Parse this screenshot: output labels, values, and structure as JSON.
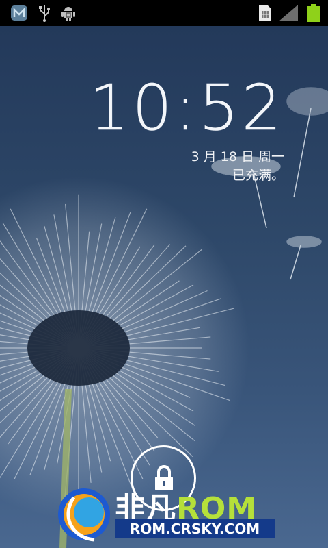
{
  "status_bar": {
    "left_icons": [
      "notification-app-icon",
      "usb-icon",
      "android-debug-icon"
    ],
    "right_icons": [
      "sim-card-icon",
      "signal-icon",
      "battery-icon"
    ],
    "battery_color": "#8fd11a"
  },
  "lockscreen": {
    "time": "10:52",
    "date": "3 月 18 日 周一",
    "charging_status": "已充满。",
    "unlock_icon": "lock-icon"
  },
  "watermark": {
    "brand_cn": "非凡",
    "brand_rom": "ROM",
    "url": "ROM.CRSKY.COM"
  }
}
